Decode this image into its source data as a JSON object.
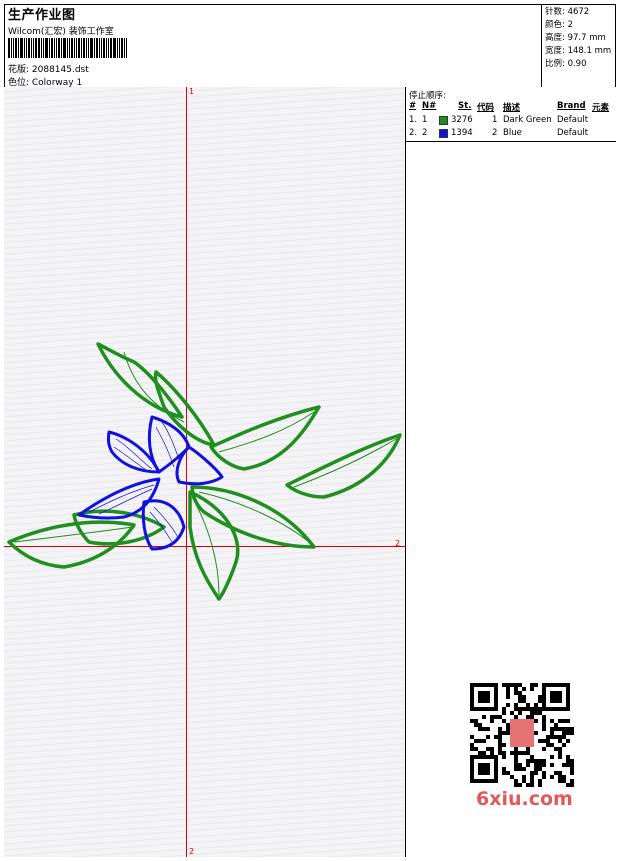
{
  "header": {
    "title": "生产作业图",
    "subtitle": "Wilcom(汇宏) 装饰工作室",
    "design_label": "花版: 2088145.dst",
    "colorway_label": "色位: Colorway 1"
  },
  "stats": {
    "stitches": "针数: 4672",
    "colors": "颜色: 2",
    "height": "高度: 97.7 mm",
    "width": "宽度: 148.1 mm",
    "scale": "比例: 0.90"
  },
  "canvas": {
    "axis_label_top": "1",
    "axis_label_right": "2",
    "axis_label_bottom": "2"
  },
  "stop_sequence": {
    "title": "停止顺序:",
    "columns": [
      "#",
      "N#",
      "St.",
      "代码",
      "描述",
      "Brand",
      "元素"
    ],
    "rows": [
      {
        "index": "1.",
        "needle": "1",
        "color": "#1f8f1f",
        "stitches": "3276",
        "code": "1",
        "description": "Dark Green",
        "brand": "Default"
      },
      {
        "index": "2.",
        "needle": "2",
        "color": "#1010e0",
        "stitches": "1394",
        "code": "2",
        "description": "Blue",
        "brand": "Default"
      }
    ]
  },
  "watermark": {
    "text": "6xiu.com",
    "seal_text": "汉字图库"
  },
  "colors": {
    "thread_green": "#1f8f1f",
    "thread_blue": "#1010e0",
    "axis_red": "#e00000"
  }
}
